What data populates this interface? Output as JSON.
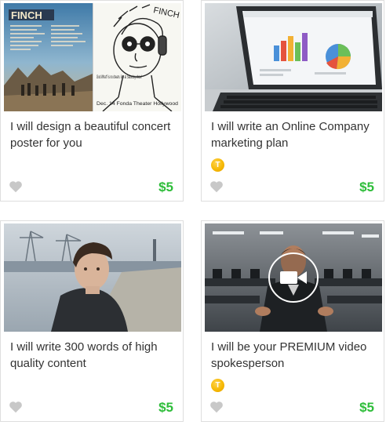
{
  "gigs": [
    {
      "title": "I will design a beautiful concert poster for you",
      "price": "$5",
      "top_rated": false,
      "poster_left_heading": "FINCH",
      "poster_right_heading": "FINCH",
      "poster_right_text": "God What? is no dream. live at Saturday show!",
      "poster_date": "Dec. 14 Fonda Theater Hollywood"
    },
    {
      "title": "I will write an Online Company marketing plan",
      "price": "$5",
      "top_rated": true,
      "badge_letter": "T"
    },
    {
      "title": "I will write 300 words of high quality content",
      "price": "$5",
      "top_rated": false
    },
    {
      "title": "I will be your PREMIUM video spokesperson",
      "price": "$5",
      "top_rated": true,
      "badge_letter": "T",
      "has_video": true
    }
  ],
  "colors": {
    "price": "#2ebd3a",
    "badge": "#f5b700",
    "heart": "#c8c8c8",
    "border": "#dedede"
  },
  "icons": {
    "favorite": "heart-icon",
    "top_rated": "top-rated-badge-icon",
    "video": "video-camera-icon"
  }
}
